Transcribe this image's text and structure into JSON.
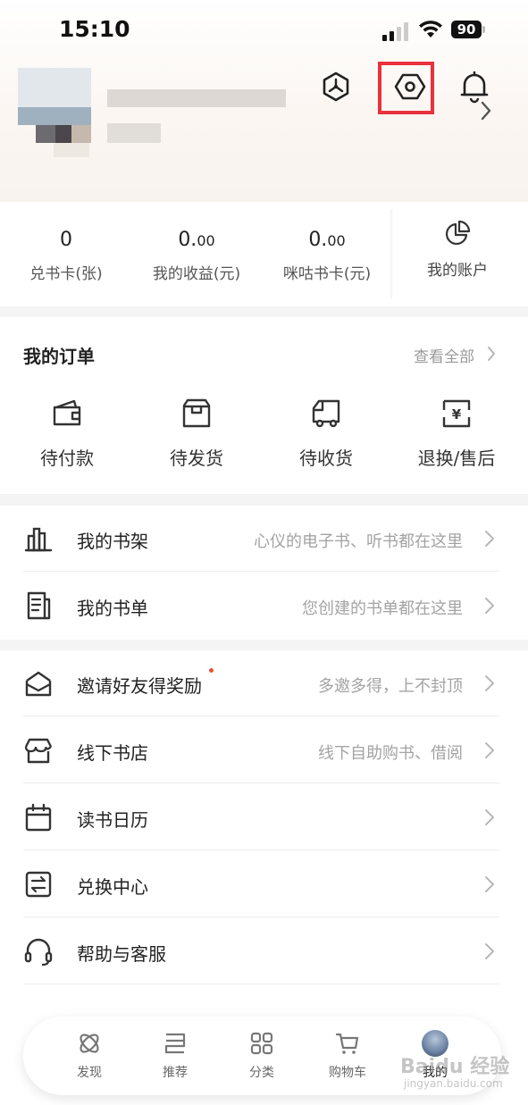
{
  "status_bar": {
    "time": "15:10",
    "battery": "90"
  },
  "stats": [
    {
      "value": "0",
      "decimal": "",
      "label": "兑书卡(张)"
    },
    {
      "value": "0.",
      "decimal": "00",
      "label": "我的收益(元)"
    },
    {
      "value": "0.",
      "decimal": "00",
      "label": "咪咕书卡(元)"
    }
  ],
  "account": {
    "label": "我的账户"
  },
  "orders": {
    "title": "我的订单",
    "view_all": "查看全部",
    "items": [
      {
        "label": "待付款",
        "icon": "wallet-icon"
      },
      {
        "label": "待发货",
        "icon": "package-icon"
      },
      {
        "label": "待收货",
        "icon": "truck-icon"
      },
      {
        "label": "退换/售后",
        "icon": "refund-icon"
      }
    ]
  },
  "library": [
    {
      "label": "我的书架",
      "hint": "心仪的电子书、听书都在这里",
      "icon": "bookshelf-icon"
    },
    {
      "label": "我的书单",
      "hint": "您创建的书单都在这里",
      "icon": "booklist-icon"
    }
  ],
  "services": [
    {
      "label": "邀请好友得奖励",
      "hint": "多邀多得，上不封顶",
      "icon": "envelope-icon"
    },
    {
      "label": "线下书店",
      "hint": "线下自助购书、借阅",
      "icon": "store-icon"
    },
    {
      "label": "读书日历",
      "hint": "",
      "icon": "calendar-icon"
    },
    {
      "label": "兑换中心",
      "hint": "",
      "icon": "exchange-icon"
    },
    {
      "label": "帮助与客服",
      "hint": "",
      "icon": "headset-icon"
    }
  ],
  "bottom_nav": [
    {
      "label": "发现",
      "icon": "discover-icon"
    },
    {
      "label": "推荐",
      "icon": "recommend-icon"
    },
    {
      "label": "分类",
      "icon": "category-icon"
    },
    {
      "label": "购物车",
      "icon": "cart-icon"
    },
    {
      "label": "我的",
      "icon": "avatar"
    }
  ],
  "watermark": {
    "text": "Baidu 经验",
    "sub": "jingyan.baidu.com"
  },
  "colors": {
    "highlight": "#e8323c",
    "accent_dot": "#e8503a"
  }
}
